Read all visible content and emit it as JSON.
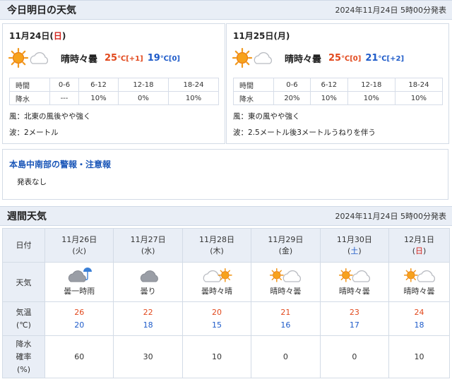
{
  "today_section": {
    "title": "今日明日の天気",
    "published": "2024年11月24日 5時00分発表"
  },
  "days": [
    {
      "date_prefix": "11月24日(",
      "weekday": "日",
      "date_suffix": ")",
      "weather": "晴時々曇",
      "high": "25",
      "high_unit": "℃",
      "high_diff": "[+1]",
      "low": "19",
      "low_unit": "℃",
      "low_diff": "[0]",
      "time_header": "時間",
      "times": [
        "0-6",
        "6-12",
        "12-18",
        "18-24"
      ],
      "pop_header": "降水",
      "pops": [
        "---",
        "10%",
        "0%",
        "10%"
      ],
      "wind": "風：北東の風後やや強く",
      "wave": "波：2メートル"
    },
    {
      "date_prefix": "11月25日(",
      "weekday": "月",
      "date_suffix": ")",
      "weather": "晴時々曇",
      "high": "25",
      "high_unit": "℃",
      "high_diff": "[0]",
      "low": "21",
      "low_unit": "℃",
      "low_diff": "[+2]",
      "time_header": "時間",
      "times": [
        "0-6",
        "6-12",
        "12-18",
        "18-24"
      ],
      "pop_header": "降水",
      "pops": [
        "20%",
        "10%",
        "10%",
        "10%"
      ],
      "wind": "風：東の風やや強く",
      "wave": "波：2.5メートル後3メートルうねりを伴う"
    }
  ],
  "warning": {
    "title": "本島中南部の警報・注意報",
    "text": "発表なし"
  },
  "weekly_section": {
    "title": "週間天気",
    "published": "2024年11月24日 5時00分発表"
  },
  "weekly": {
    "row_labels": {
      "date": "日付",
      "weather": "天気",
      "temp_line1": "気温",
      "temp_line2": "(℃)",
      "pop_line1": "降水",
      "pop_line2": "確率",
      "pop_line3": "(%)"
    },
    "days": [
      {
        "date": "11月26日",
        "wd_open": "(",
        "wd": "火",
        "wd_close": ")",
        "wd_type": "weekday",
        "weather": "曇一時雨",
        "icon": "cloud-rain-icon",
        "high": "26",
        "low": "20",
        "pop": "60"
      },
      {
        "date": "11月27日",
        "wd_open": "(",
        "wd": "水",
        "wd_close": ")",
        "wd_type": "weekday",
        "weather": "曇り",
        "icon": "cloud-icon",
        "high": "22",
        "low": "18",
        "pop": "30"
      },
      {
        "date": "11月28日",
        "wd_open": "(",
        "wd": "木",
        "wd_close": ")",
        "wd_type": "weekday",
        "weather": "曇時々晴",
        "icon": "cloud-sun-icon",
        "high": "20",
        "low": "15",
        "pop": "10"
      },
      {
        "date": "11月29日",
        "wd_open": "(",
        "wd": "金",
        "wd_close": ")",
        "wd_type": "weekday",
        "weather": "晴時々曇",
        "icon": "sun-cloud-icon",
        "high": "21",
        "low": "16",
        "pop": "0"
      },
      {
        "date": "11月30日",
        "wd_open": "(",
        "wd": "土",
        "wd_close": ")",
        "wd_type": "saturday",
        "weather": "晴時々曇",
        "icon": "sun-cloud-icon",
        "high": "23",
        "low": "17",
        "pop": "0"
      },
      {
        "date": "12月1日",
        "wd_open": "(",
        "wd": "日",
        "wd_close": ")",
        "wd_type": "sunday",
        "weather": "晴時々曇",
        "icon": "sun-cloud-icon",
        "high": "24",
        "low": "18",
        "pop": "10"
      }
    ]
  },
  "colors": {
    "header_bg": "#e9eef6",
    "high_temp": "#e2491d",
    "low_temp": "#1e5bc9",
    "sunday": "#d2261f",
    "saturday": "#1e5bc9",
    "warning_title": "#1a56b8"
  }
}
